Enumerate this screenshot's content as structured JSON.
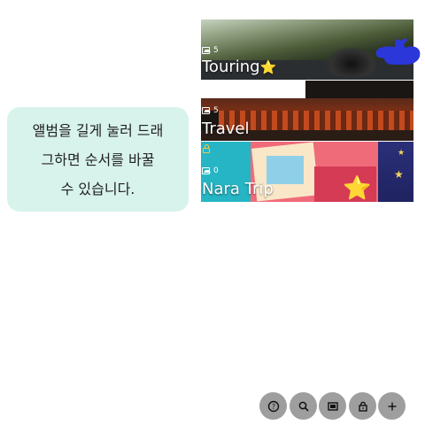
{
  "tooltip": {
    "lines": [
      "앨범을 길게 눌러 드래",
      "그하면 순서를 바꿀",
      "수 있습니다."
    ]
  },
  "albums": [
    {
      "title": "Touring",
      "title_badge": "⭐",
      "count": "5",
      "locked": false
    },
    {
      "title": "Travel",
      "count": "5",
      "locked": false
    },
    {
      "title": "Nara Trip",
      "count": "0",
      "locked": true,
      "badge": "⭐"
    }
  ],
  "gesture": {
    "icon": "pointing-hand-icon",
    "color": "#2b37d8"
  },
  "fabs": [
    {
      "name": "help-button",
      "icon": "question-icon",
      "glyph": "?"
    },
    {
      "name": "search-button",
      "icon": "search-icon"
    },
    {
      "name": "gallery-button",
      "icon": "image-icon"
    },
    {
      "name": "lock-button",
      "icon": "lock-icon"
    },
    {
      "name": "add-button",
      "icon": "plus-icon",
      "glyph": "+"
    }
  ],
  "colors": {
    "tooltip_bg": "#d8f3ec",
    "fab_bg": "#9e9e9e",
    "lock": "#f6c744"
  }
}
